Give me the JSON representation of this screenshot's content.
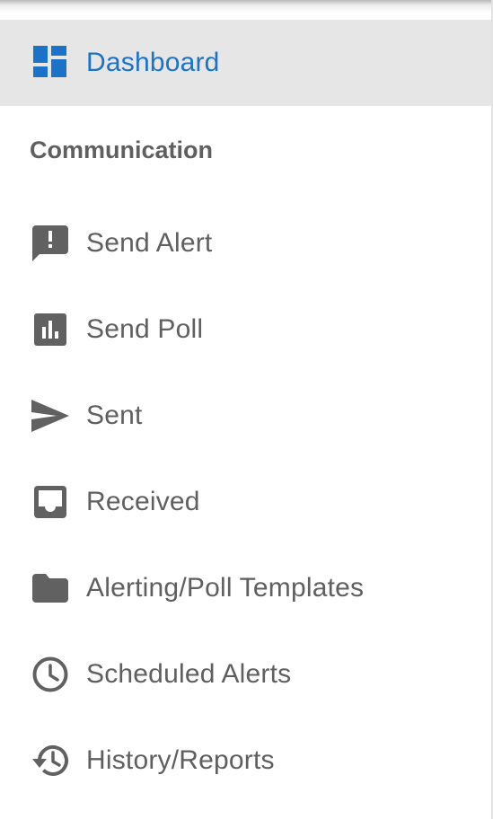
{
  "colors": {
    "accent": "#1a73c8",
    "text": "#5f5f5f",
    "icon": "#616161",
    "active_background": "#e6e6e6"
  },
  "nav": {
    "dashboard": {
      "label": "Dashboard",
      "icon": "dashboard-icon",
      "active": true
    },
    "section_header": "Communication",
    "items": [
      {
        "label": "Send Alert",
        "icon": "alert-message-icon"
      },
      {
        "label": "Send Poll",
        "icon": "poll-chart-icon"
      },
      {
        "label": "Sent",
        "icon": "send-icon"
      },
      {
        "label": "Received",
        "icon": "inbox-icon"
      },
      {
        "label": "Alerting/Poll Templates",
        "icon": "folder-icon"
      },
      {
        "label": "Scheduled Alerts",
        "icon": "clock-icon"
      },
      {
        "label": "History/Reports",
        "icon": "history-icon"
      }
    ]
  }
}
